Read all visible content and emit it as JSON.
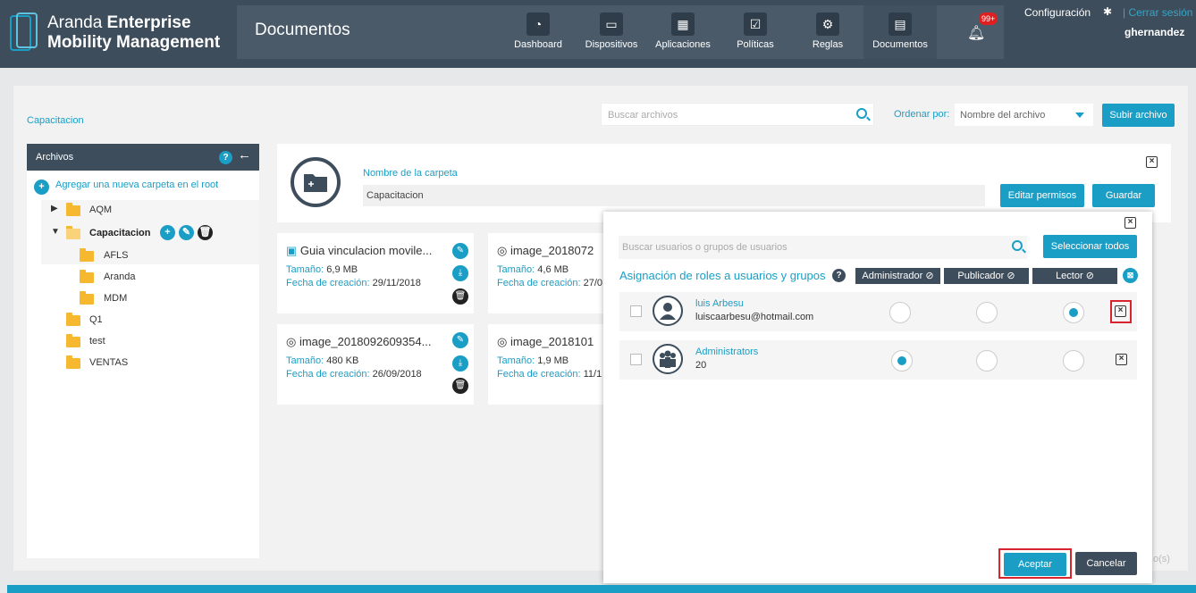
{
  "brand": {
    "line1_light": "Aranda ",
    "line1_bold": "Enterprise",
    "line2": "Mobility Management"
  },
  "header": {
    "title": "Documentos"
  },
  "nav": [
    {
      "label": "Dashboard",
      "icon": "dashboard-icon"
    },
    {
      "label": "Dispositivos",
      "icon": "devices-icon"
    },
    {
      "label": "Aplicaciones",
      "icon": "apps-grid-icon"
    },
    {
      "label": "Políticas",
      "icon": "policies-icon"
    },
    {
      "label": "Reglas",
      "icon": "rules-icon"
    },
    {
      "label": "Documentos",
      "icon": "documents-icon"
    }
  ],
  "notifications": {
    "badge": "99+"
  },
  "account": {
    "config": "Configuración",
    "logout": "Cerrar sesión",
    "username": "ghernandez"
  },
  "breadcrumb": "Capacitacion",
  "search": {
    "placeholder": "Buscar archivos"
  },
  "order": {
    "label": "Ordenar por:",
    "selected": "Nombre del archivo"
  },
  "upload_label": "Subir archivo",
  "sidebar": {
    "title": "Archivos",
    "help": "?",
    "add_root": "Agregar una nueva carpeta en el root",
    "folders": [
      "AQM",
      "Capacitacion",
      "AFLS",
      "Aranda",
      "MDM",
      "Q1",
      "test",
      "VENTAS"
    ]
  },
  "folder_panel": {
    "label": "Nombre de la carpeta",
    "value": "Capacitacion",
    "edit_perms": "Editar permisos",
    "save": "Guardar"
  },
  "files": [
    {
      "name": "Guia vinculacion movile...",
      "size_label": "Tamaño:",
      "size": "6,9 MB",
      "date_label": "Fecha de creación:",
      "date": "29/11/2018"
    },
    {
      "name": "image_2018072",
      "size_label": "Tamaño:",
      "size": "4,6 MB",
      "date_label": "Fecha de creación:",
      "date": "27/0"
    },
    {
      "name": "image_2018092609354...",
      "size_label": "Tamaño:",
      "size": "480 KB",
      "date_label": "Fecha de creación:",
      "date": "26/09/2018"
    },
    {
      "name": "image_2018101",
      "size_label": "Tamaño:",
      "size": "1,9 MB",
      "date_label": "Fecha de creación:",
      "date": "11/1"
    }
  ],
  "modal": {
    "search_placeholder": "Buscar usuarios o grupos de usuarios",
    "select_all": "Seleccionar todos",
    "assign_title": "Asignación de roles a usuarios y grupos",
    "roles": [
      "Administrador",
      "Publicador",
      "Lector"
    ],
    "entries": [
      {
        "name": "luis Arbesu",
        "detail": "luiscaarbesu@hotmail.com",
        "role": "Lector"
      },
      {
        "name": "Administrators",
        "detail": "20",
        "role": "Administrador"
      }
    ],
    "accept": "Aceptar",
    "cancel": "Cancelar"
  },
  "footer_partial": "o(s)",
  "colors": {
    "accent": "#1a9ec5",
    "header": "#3d4d5c",
    "highlight": "#d9232e",
    "folder": "#f5b82e"
  }
}
